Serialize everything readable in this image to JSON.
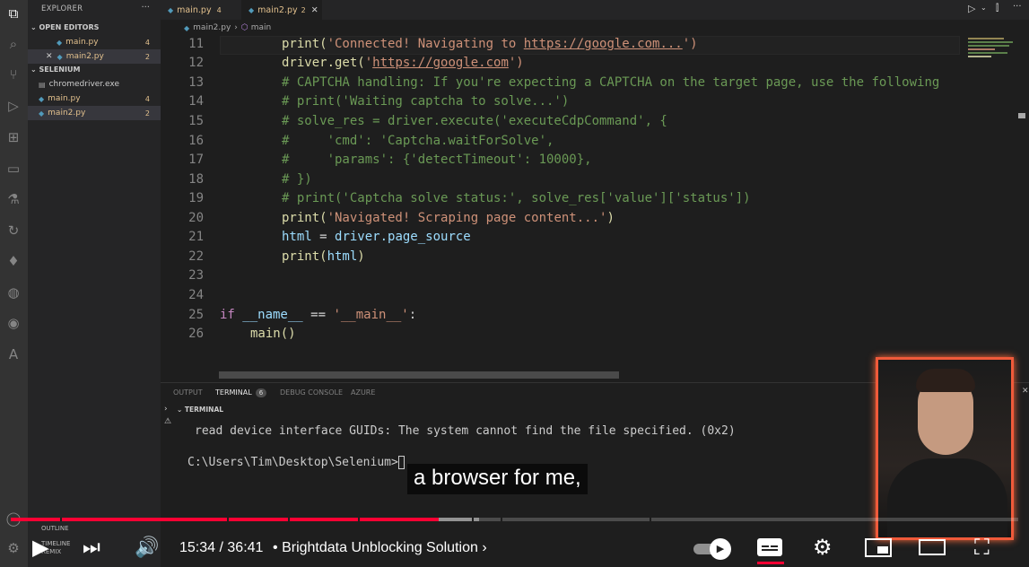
{
  "sidebar": {
    "header": "EXPLORER",
    "more": "···",
    "open_editors_label": "OPEN EDITORS",
    "open_editors": [
      {
        "name": "main.py",
        "count": "4"
      },
      {
        "name": "main2.py",
        "count": "2"
      }
    ],
    "folder_label": "SELENIUM",
    "files": [
      {
        "name": "chromedriver.exe",
        "count": ""
      },
      {
        "name": "main.py",
        "count": "4"
      },
      {
        "name": "main2.py",
        "count": "2"
      }
    ],
    "outline_label": "OUTLINE",
    "timeline_label": "TIMELINE",
    "remix_label": "REMIX"
  },
  "tabs": [
    {
      "label": "main.py",
      "count": "4"
    },
    {
      "label": "main2.py",
      "count": "2"
    }
  ],
  "breadcrumb": {
    "file": "main2.py",
    "symbol": "main"
  },
  "editor": {
    "line_numbers": [
      "11",
      "12",
      "13",
      "14",
      "15",
      "16",
      "17",
      "18",
      "19",
      "20",
      "21",
      "22",
      "23",
      "24",
      "25",
      "26"
    ],
    "lines": {
      "l11_a": "print(",
      "l11_b": "'Connected! Navigating to ",
      "l11_url": "https://google.com...",
      "l11_c": "')",
      "l12_a": "driver.get(",
      "l12_b": "'",
      "l12_url": "https://google.com",
      "l12_c": "')",
      "l13": "# CAPTCHA handling: If you're expecting a CAPTCHA on the target page, use the following",
      "l14": "# print('Waiting captcha to solve...')",
      "l15": "# solve_res = driver.execute('executeCdpCommand', {",
      "l16": "#     'cmd': 'Captcha.waitForSolve',",
      "l17": "#     'params': {'detectTimeout': 10000},",
      "l18": "# })",
      "l19": "# print('Captcha solve status:', solve_res['value']['status'])",
      "l20_a": "print(",
      "l20_b": "'Navigated! Scraping page content...'",
      "l20_c": ")",
      "l21_a": "html",
      "l21_b": " = ",
      "l21_c": "driver.page_source",
      "l22_a": "print(",
      "l22_b": "html",
      "l22_c": ")",
      "l25_a": "if",
      "l25_b": " __name__ ",
      "l25_c": "==",
      "l25_d": " '__main__'",
      "l25_e": ":",
      "l26": "main()"
    }
  },
  "panel": {
    "tabs": [
      "OUTPUT",
      "TERMINAL",
      "DEBUG CONSOLE",
      "AZURE"
    ],
    "terminal_badge": "6",
    "section_label": "TERMINAL",
    "output_line": "read device interface GUIDs: The system cannot find the file specified. (0x2)",
    "prompt": "C:\\Users\\Tim\\Desktop\\Selenium>"
  },
  "video": {
    "caption": "a browser for me,",
    "time_current": "15:34",
    "time_sep": " / ",
    "time_total": "36:41",
    "chapter_bullet": "•",
    "chapter": "Brightdata Unblocking Solution",
    "progress_played": 0.425,
    "progress_buffered": 0.465
  },
  "colors": {
    "accent": "#ff0033",
    "warning_yellow": "#e2c08d",
    "cam_border": "#f05a3a"
  }
}
